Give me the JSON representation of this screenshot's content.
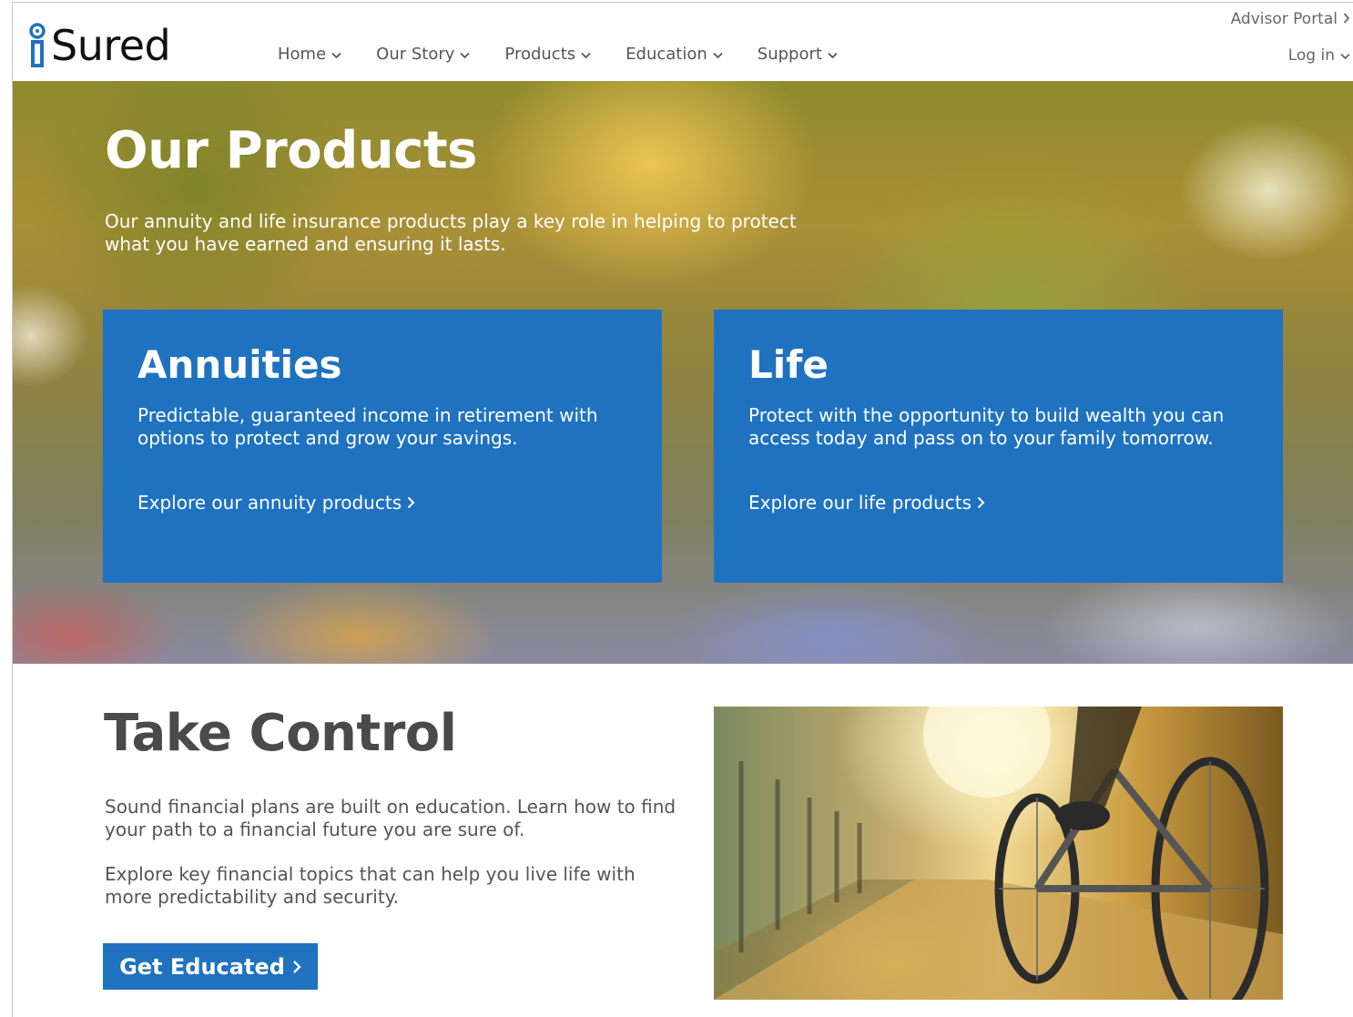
{
  "brand": {
    "name": "Sured",
    "accent": "#1f72bf"
  },
  "nav": {
    "items": [
      {
        "label": "Home"
      },
      {
        "label": "Our Story"
      },
      {
        "label": "Products"
      },
      {
        "label": "Education"
      },
      {
        "label": "Support"
      }
    ]
  },
  "utility": {
    "advisor_portal": "Advisor Portal",
    "login": "Log in"
  },
  "hero": {
    "title": "Our Products",
    "subtitle": "Our annuity and life insurance products play a key role in helping to protect what you have earned and ensuring it lasts."
  },
  "cards": [
    {
      "title": "Annuities",
      "body": "Predictable, guaranteed income in retirement with options to protect and grow your savings.",
      "link": "Explore our annuity products"
    },
    {
      "title": "Life",
      "body": "Protect with the opportunity to build wealth you can access today and pass on to your family tomorrow.",
      "link": "Explore our life products"
    }
  ],
  "take_control": {
    "title": "Take Control",
    "p1": "Sound financial plans are built on education. Learn how to find your path to a financial future you are sure of.",
    "p2": "Explore key financial topics that can help you live life with more predictability and security.",
    "cta": "Get Educated"
  },
  "icons": {
    "chevron_down": "chevron-down-icon",
    "chevron_right": "chevron-right-icon",
    "logo_mark": "logo-i-mark-icon"
  }
}
